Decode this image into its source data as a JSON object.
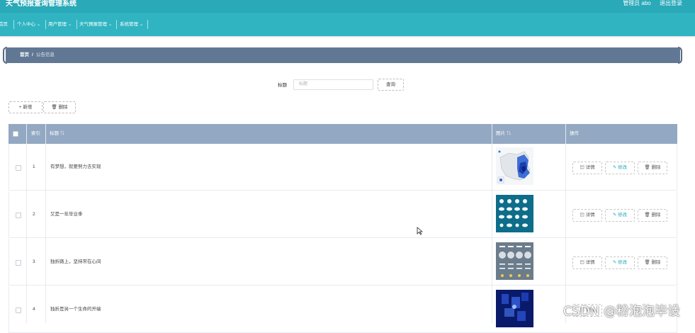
{
  "header": {
    "app_title": "天气预报查询管理系统",
    "user_label": "管理员 abo",
    "logout_label": "退出登录"
  },
  "nav": {
    "items": [
      {
        "label": "首页"
      },
      {
        "label": "个人中心"
      },
      {
        "label": "用户管理"
      },
      {
        "label": "天气预报管理"
      },
      {
        "label": "系统管理"
      }
    ],
    "chevron_icon": "chevron-down-icon"
  },
  "breadcrumb": {
    "home": "首页",
    "separator": "/",
    "current": "公告信息"
  },
  "search": {
    "label": "标题",
    "placeholder": "标题",
    "button_label": "查询"
  },
  "toolbar": {
    "add_label": "+ 新增",
    "delete_label": "删除",
    "delete_icon": "trash-icon"
  },
  "table": {
    "columns": {
      "index": "索引",
      "title": "标题",
      "image": "图片",
      "actions": "操作"
    },
    "rows": [
      {
        "index": "1",
        "title": "有梦想，就要努力去实现"
      },
      {
        "index": "2",
        "title": "又是一年毕业季"
      },
      {
        "index": "3",
        "title": "独折路上，坚持常在心间"
      },
      {
        "index": "4",
        "title": "独折是另一个生命的开端"
      }
    ],
    "actions": {
      "detail": "详情",
      "edit": "修改",
      "delete": "删除"
    }
  },
  "watermark": "CSDN @粉泡泡毕设",
  "colors": {
    "topbar": "#2aa9b8",
    "breadcrumb_bg": "#617894",
    "table_header": "#93a8c2"
  }
}
